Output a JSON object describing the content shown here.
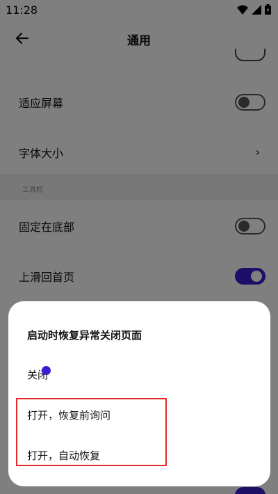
{
  "status_bar": {
    "time": "11:28"
  },
  "app_bar": {
    "title": "通用"
  },
  "settings": {
    "items": [
      {
        "label": "适应屏幕",
        "toggle": "off"
      },
      {
        "label": "字体大小",
        "chevron": "›"
      },
      {
        "label": "固定在底部",
        "toggle": "off"
      },
      {
        "label": "上滑回首页",
        "toggle": "on"
      }
    ],
    "section_header": "工具栏"
  },
  "dialog": {
    "title": "启动时恢复异常关闭页面",
    "options": [
      {
        "label": "关闭"
      },
      {
        "label": "打开，恢复前询问"
      },
      {
        "label": "打开，自动恢复"
      }
    ]
  },
  "colors": {
    "accent": "#3b1fd0",
    "highlight": "#e32b2b"
  }
}
